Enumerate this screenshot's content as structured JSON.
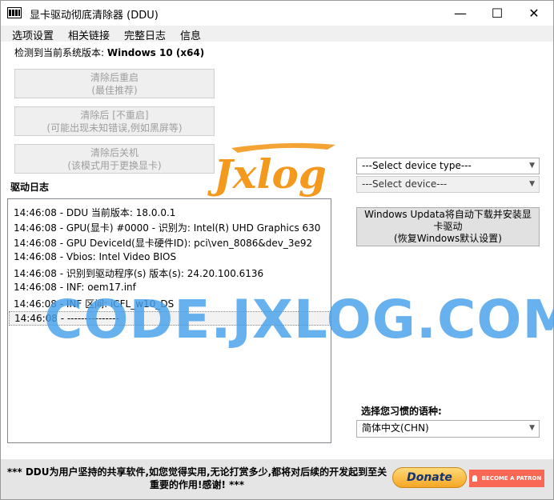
{
  "window": {
    "title": "显卡驱动彻底清除器 (DDU)",
    "minimize": "—",
    "maximize": "☐",
    "close": "✕"
  },
  "menu": [
    "选项设置",
    "相关链接",
    "完整日志",
    "信息"
  ],
  "detected": {
    "prefix": "检测到当前系统版本: ",
    "os": "Windows 10 (x64)"
  },
  "actions": [
    {
      "line1": "清除后重启",
      "line2": "(最佳推荐)"
    },
    {
      "line1": "清除后 [不重启]",
      "line2": "(可能出现未知错误,例如黑屏等)"
    },
    {
      "line1": "清除后关机",
      "line2": "(该模式用于更换显卡)"
    }
  ],
  "log": {
    "label": "驱动日志",
    "lines": [
      "14:46:08 - DDU 当前版本: 18.0.0.1",
      "14:46:08 - GPU(显卡) #0000 - 识别为: Intel(R) UHD Graphics 630",
      "14:46:08 - GPU DeviceId(显卡硬件ID): pci\\ven_8086&dev_3e92",
      "14:46:08 - Vbios: Intel Video BIOS",
      "14:46:08 - 识别到驱动程序(s) 版本(s): 24.20.100.6136",
      "14:46:08 - INF: oem17.inf",
      "14:46:08 - INF 区间: iCFL_w10_DS",
      "14:46:08 - ---------------"
    ]
  },
  "device_type": {
    "value": "---Select device type---",
    "arrow": "▼"
  },
  "device": {
    "value": "---Select device---",
    "arrow": "▼"
  },
  "windows_update": {
    "line1": "Windows Updata将自动下载并安装显",
    "line2": "卡驱动",
    "line3": "(恢复Windows默认设置)"
  },
  "language": {
    "label": "选择您习惯的语种:",
    "value": "简体中文(CHN)",
    "arrow": "▼"
  },
  "footer": {
    "text_line1": "*** DDU为用户坚持的共享软件,如您觉得实用,无论打赏多少,都将对后续的开发起到至关",
    "text_line2": "重要的作用!感谢! ***",
    "donate": "Donate",
    "patron": "BECOME A PATRON"
  },
  "watermark": {
    "logo": "Jxlog",
    "text": "CODE.JXLOG.COM"
  },
  "colors": {
    "watermark_blue": "#46a0eb",
    "logo_orange": "#f39a1e",
    "patron_red": "#f96854",
    "donate_gold": "#f5a623"
  }
}
